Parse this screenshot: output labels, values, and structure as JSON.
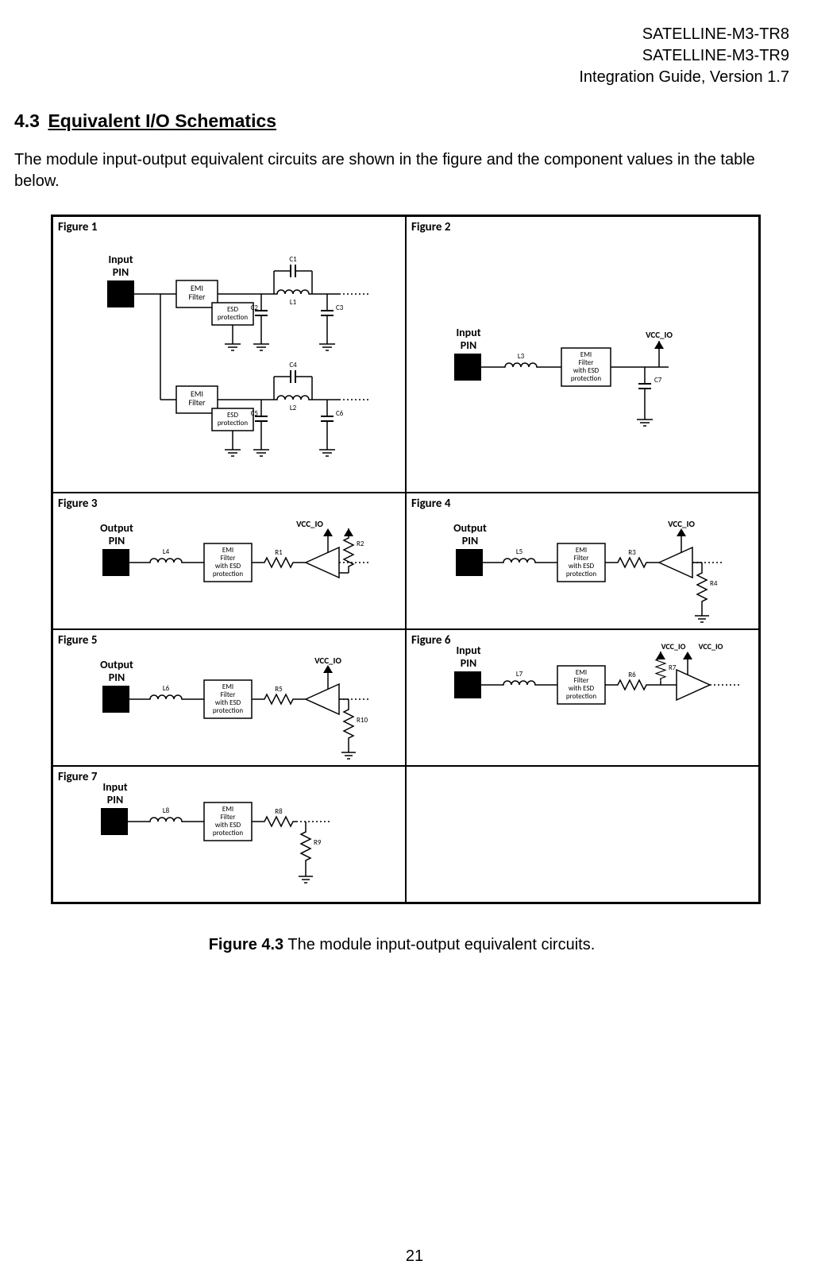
{
  "header": {
    "l1": "SATELLINE-M3-TR8",
    "l2": "SATELLINE-M3-TR9",
    "l3": "Integration Guide, Version 1.7"
  },
  "section": {
    "num": "4.3",
    "title": "Equivalent I/O Schematics"
  },
  "paragraph": "The module input-output equivalent circuits are shown in the figure and the component values in the table below.",
  "fig": {
    "f1": "Figure 1",
    "f2": "Figure 2",
    "f3": "Figure 3",
    "f4": "Figure 4",
    "f5": "Figure 5",
    "f6": "Figure 6",
    "f7": "Figure 7"
  },
  "lbl": {
    "input": "Input",
    "output": "Output",
    "pin": "PIN",
    "emi_filter_1": "EMI",
    "emi_filter_2": "Filter",
    "esd_1": "ESD",
    "esd_2": "protection",
    "emi_esd_1": "EMI",
    "emi_esd_2": "Filter",
    "emi_esd_3": "with ESD",
    "emi_esd_4": "protection",
    "vcc_io": "VCC_IO",
    "C1": "C1",
    "C2": "C2",
    "C3": "C3",
    "C4": "C4",
    "C5": "C5",
    "C6": "C6",
    "C7": "C7",
    "L1": "L1",
    "L2": "L2",
    "L3": "L3",
    "L4": "L4",
    "L5": "L5",
    "L6": "L6",
    "L7": "L7",
    "L8": "L8",
    "R1": "R1",
    "R2": "R2",
    "R3": "R3",
    "R4": "R4",
    "R5": "R5",
    "R6": "R6",
    "R7": "R7",
    "R8": "R8",
    "R9": "R9",
    "R10": "R10"
  },
  "caption": {
    "b": "Figure 4.3",
    "t": " The module input-output equivalent circuits."
  },
  "pagenum": "21"
}
